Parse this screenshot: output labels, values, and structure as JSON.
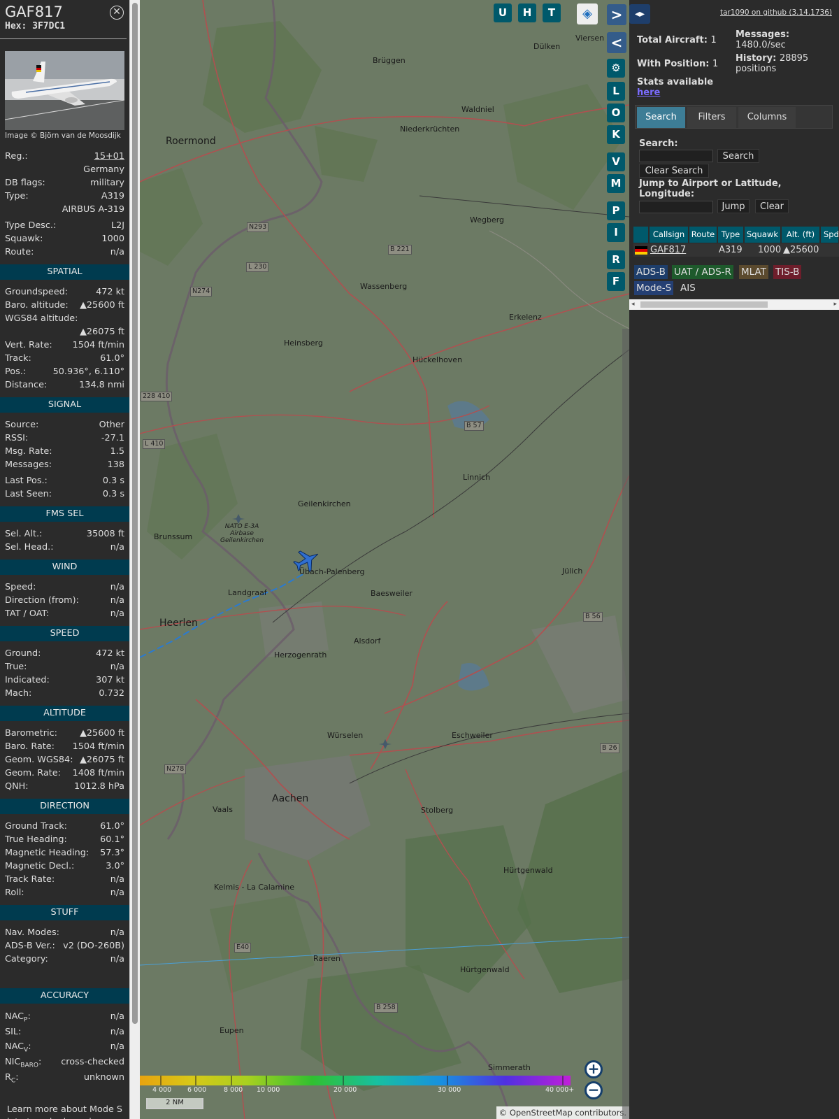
{
  "detail": {
    "callsign": "GAF817",
    "hex_label": "Hex:",
    "hex": "3F7DC1",
    "photo_credit": "Image © Björn van de Moosdijk",
    "reg_label": "Reg.:",
    "reg": "15+01",
    "country": "Germany",
    "dbflags_label": "DB flags:",
    "dbflags": "military",
    "type_label": "Type:",
    "type": "A319",
    "type_name": "AIRBUS A-319",
    "typedesc_label": "Type Desc.:",
    "typedesc": "L2J",
    "squawk_label": "Squawk:",
    "squawk": "1000",
    "route_label": "Route:",
    "route": "n/a"
  },
  "sections": {
    "spatial": "SPATIAL",
    "signal": "SIGNAL",
    "fms": "FMS SEL",
    "wind": "WIND",
    "speed": "SPEED",
    "altitude": "ALTITUDE",
    "direction": "DIRECTION",
    "stuff": "STUFF",
    "accuracy": "ACCURACY"
  },
  "spatial": {
    "gs_l": "Groundspeed:",
    "gs": "472 kt",
    "baro_l": "Baro. altitude:",
    "baro": "▲25600 ft",
    "wgs_l": "WGS84 altitude:",
    "wgs": "▲26075 ft",
    "vr_l": "Vert. Rate:",
    "vr": "1504 ft/min",
    "track_l": "Track:",
    "track": "61.0°",
    "pos_l": "Pos.:",
    "pos": "50.936°, 6.110°",
    "dist_l": "Distance:",
    "dist": "134.8 nmi"
  },
  "signal": {
    "src_l": "Source:",
    "src": "Other",
    "rssi_l": "RSSI:",
    "rssi": "-27.1",
    "rate_l": "Msg. Rate:",
    "rate": "1.5",
    "msgs_l": "Messages:",
    "msgs": "138",
    "lastpos_l": "Last Pos.:",
    "lastpos": "0.3 s",
    "lastseen_l": "Last Seen:",
    "lastseen": "0.3 s"
  },
  "fms": {
    "alt_l": "Sel. Alt.:",
    "alt": "35008 ft",
    "head_l": "Sel. Head.:",
    "head": "n/a"
  },
  "wind": {
    "speed_l": "Speed:",
    "speed": "n/a",
    "dir_l": "Direction (from):",
    "dir": "n/a",
    "tat_l": "TAT / OAT:",
    "tat": "n/a"
  },
  "speed": {
    "ground_l": "Ground:",
    "ground": "472 kt",
    "true_l": "True:",
    "true": "n/a",
    "ind_l": "Indicated:",
    "ind": "307 kt",
    "mach_l": "Mach:",
    "mach": "0.732"
  },
  "altitude": {
    "baro_l": "Barometric:",
    "baro": "▲25600 ft",
    "brate_l": "Baro. Rate:",
    "brate": "1504 ft/min",
    "geom_l": "Geom. WGS84:",
    "geom": "▲26075 ft",
    "grate_l": "Geom. Rate:",
    "grate": "1408 ft/min",
    "qnh_l": "QNH:",
    "qnh": "1012.8 hPa"
  },
  "direction": {
    "gt_l": "Ground Track:",
    "gt": "61.0°",
    "th_l": "True Heading:",
    "th": "60.1°",
    "mh_l": "Magnetic Heading:",
    "mh": "57.3°",
    "md_l": "Magnetic Decl.:",
    "md": "3.0°",
    "tr_l": "Track Rate:",
    "tr": "n/a",
    "roll_l": "Roll:",
    "roll": "n/a"
  },
  "stuff": {
    "nav_l": "Nav. Modes:",
    "nav": "n/a",
    "adsb_l": "ADS-B Ver.:",
    "adsb": "v2 (DO-260B)",
    "cat_l": "Category:",
    "cat": "n/a"
  },
  "accuracy": {
    "nacp_l": "NAC",
    "nacp_sub": "P",
    "nacp": "n/a",
    "sil_l": "SIL:",
    "sil": "n/a",
    "nacv_l": "NAC",
    "nacv_sub": "V",
    "nacv": "n/a",
    "nicb_l": "NIC",
    "nicb_sub": "BARO",
    "nicb": "cross-checked",
    "rc_l": "R",
    "rc_sub": "C",
    "rc": "unknown"
  },
  "learn_more": "Learn more about Mode S data type by hovering over each data label.",
  "map": {
    "buttons": [
      "U",
      "H",
      "T"
    ],
    "side_buttons": [
      "L",
      "O",
      "K",
      "V",
      "M",
      "P",
      "I",
      "R",
      "F"
    ],
    "places": [
      {
        "name": "Roermond"
      },
      {
        "name": "Brüggen"
      },
      {
        "name": "Dülken"
      },
      {
        "name": "Viersen"
      },
      {
        "name": "Waldniel"
      },
      {
        "name": "Niederkrüchten"
      },
      {
        "name": "Wegberg"
      },
      {
        "name": "Wassenberg"
      },
      {
        "name": "Erkelenz"
      },
      {
        "name": "Heinsberg"
      },
      {
        "name": "Hückelhoven"
      },
      {
        "name": "Linnich"
      },
      {
        "name": "Geilenkirchen"
      },
      {
        "name": "Brunssum"
      },
      {
        "name": "Übach-Palenberg"
      },
      {
        "name": "Baesweiler"
      },
      {
        "name": "Jülich"
      },
      {
        "name": "Landgraaf"
      },
      {
        "name": "Heerlen"
      },
      {
        "name": "Alsdorf"
      },
      {
        "name": "Herzogenrath"
      },
      {
        "name": "Würselen"
      },
      {
        "name": "Eschweiler"
      },
      {
        "name": "Aachen"
      },
      {
        "name": "Vaals"
      },
      {
        "name": "Stolberg"
      },
      {
        "name": "Hürtgenwald"
      },
      {
        "name": "Kelmis - La Calamine"
      },
      {
        "name": "Raeren"
      },
      {
        "name": "Eupen"
      },
      {
        "name": "Simmerath"
      },
      {
        "name": "Hürtgenwald"
      }
    ],
    "roads": [
      "B 221",
      "N293",
      "L 230",
      "N274",
      "228 410",
      "L 410",
      "B 57",
      "B 56",
      "N278",
      "E40",
      "B 258",
      "B 26"
    ],
    "altitude_scale": [
      "4 000",
      "6 000",
      "8 000",
      "10 000",
      "20 000",
      "30 000",
      "40 000+"
    ],
    "scale": "2 NM",
    "attribution": "© OpenStreetMap contributors.",
    "airbase": "NATO E-3A Airbase Geilenkirchen"
  },
  "right": {
    "github": "tar1090 on github (3.14.1736)",
    "total_l": "Total Aircraft:",
    "total": "1",
    "withpos_l": "With Position:",
    "withpos": "1",
    "stats_l": "Stats available",
    "stats_link": "here",
    "msgs_l": "Messages:",
    "msgs": "1480.0/sec",
    "hist_l": "History:",
    "hist": "28895 positions",
    "tabs": [
      "Search",
      "Filters",
      "Columns"
    ],
    "search_l": "Search:",
    "search_btn": "Search",
    "clear_search_btn": "Clear Search",
    "jump_l": "Jump to Airport or Latitude, Longitude:",
    "jump_btn": "Jump",
    "clear_btn": "Clear",
    "columns": [
      "Callsign",
      "Route",
      "Type",
      "Squawk",
      "Alt. (ft)",
      "Spd"
    ],
    "row": {
      "callsign": "GAF817",
      "type": "A319",
      "squawk": "1000",
      "alt": "▲25600"
    },
    "badges": [
      "ADS-B",
      "UAT / ADS-R",
      "MLAT",
      "TIS-B",
      "Mode-S",
      "AIS"
    ]
  },
  "colors": {
    "section_bg": "#003b4f",
    "button_bg": "#00596b",
    "tab_active": "#3d7d96",
    "adsb": "#1e3e6b",
    "uat": "#1e5a2c",
    "mlat": "#5b4a2e",
    "tisb": "#6e1e2b",
    "modes": "#243f73"
  }
}
